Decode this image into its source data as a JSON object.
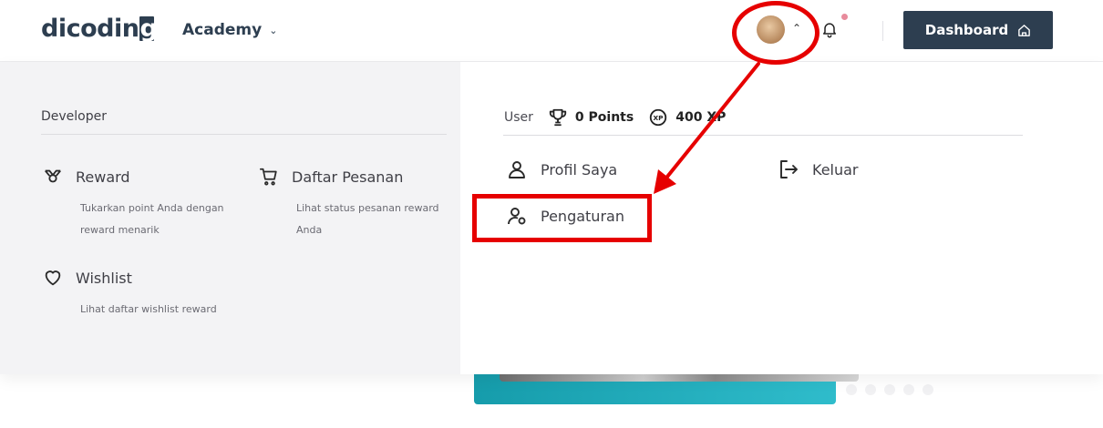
{
  "header": {
    "logo_text": "dicodin",
    "logo_g": "g",
    "nav_academy": "Academy",
    "dashboard_label": "Dashboard"
  },
  "left_panel": {
    "section_title": "Developer",
    "items": [
      {
        "title": "Reward",
        "desc": "Tukarkan point Anda dengan reward menarik",
        "icon": "reward-icon"
      },
      {
        "title": "Daftar Pesanan",
        "desc": "Lihat status pesanan reward Anda",
        "icon": "cart-icon"
      },
      {
        "title": "Wishlist",
        "desc": "Lihat daftar wishlist reward",
        "icon": "heart-icon"
      }
    ]
  },
  "right_panel": {
    "user_label": "User",
    "points": "0 Points",
    "xp": "400 XP",
    "items": [
      {
        "title": "Profil Saya",
        "icon": "user-icon"
      },
      {
        "title": "Keluar",
        "icon": "logout-icon"
      },
      {
        "title": "Pengaturan",
        "icon": "user-settings-icon"
      }
    ]
  },
  "colors": {
    "brand": "#2d3e50",
    "annotation": "#e60000",
    "notification_dot": "#e88b9c",
    "banner": "#1aa6b4"
  }
}
